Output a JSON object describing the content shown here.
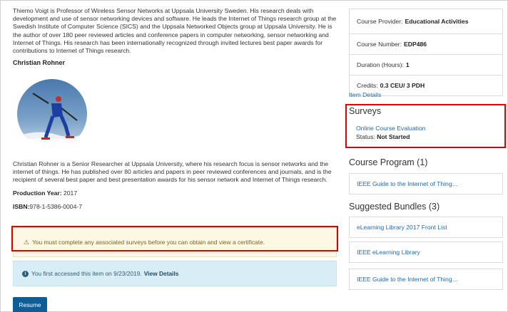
{
  "left": {
    "bio_voigt": "Thiemo Voigt is Professor of Wireless Sensor Networks at Uppsala University Sweden. His research deals with development and use of sensor networking devices and software. He leads the Internet of Things research group at the Swedish Institute of Computer Science (SICS) and the Uppsala Networked Objects group at Uppsala University. He is the author of over 180 peer reviewed articles and conference papers in computer networking, sensor networking and Internet of Things. His research has been internationally recognized through invited lectures best paper awards for contributions to Internet of Things research.",
    "name_rohner": "Christian Rohner",
    "bio_rohner": "Christian Rohner is a Senior Researcher at Uppsala University, where his research focus is sensor networks and the internet of things. He has published over 80 articles and papers in peer reviewed conferences and journals, and is the recipient of several best paper and best presentation awards for his sensor network and Internet of Things research.",
    "production_year_label": "Production Year:",
    "production_year": "2017",
    "isbn_label": "ISBN:",
    "isbn": "978-1-5386-0004-7",
    "warning_text": "You must complete any associated surveys before you can obtain and view a certificate.",
    "info_text": "You first accessed this item on 9/23/2019.",
    "info_link": "View Details",
    "resume_label": "Resume"
  },
  "right": {
    "provider_label": "Course Provider:",
    "provider_value": "Educational Activities",
    "number_label": "Course Number:",
    "number_value": "EDP486",
    "duration_label": "Duration (Hours):",
    "duration_value": "1",
    "credits_label": "Credits:",
    "credits_value": "0.3 CEU/ 3 PDH",
    "item_details_link": "Item Details",
    "surveys_title": "Surveys",
    "survey_link": "Online Course Evaluation",
    "survey_status_label": "Status:",
    "survey_status_value": "Not Started",
    "course_program_title": "Course Program (1)",
    "course_program_item": "IEEE Guide to the Internet of Thing…",
    "bundles_title": "Suggested Bundles (3)",
    "bundles": [
      "eLearning Library 2017 Front List",
      "IEEE eLearning Library",
      "IEEE Guide to the Internet of Thing…"
    ]
  },
  "colors": {
    "highlight_red": "#e00000",
    "link_blue": "#1f6aa8",
    "button_blue": "#0d5e96",
    "warning_bg": "#fcf8e3",
    "info_bg": "#d9edf7"
  }
}
